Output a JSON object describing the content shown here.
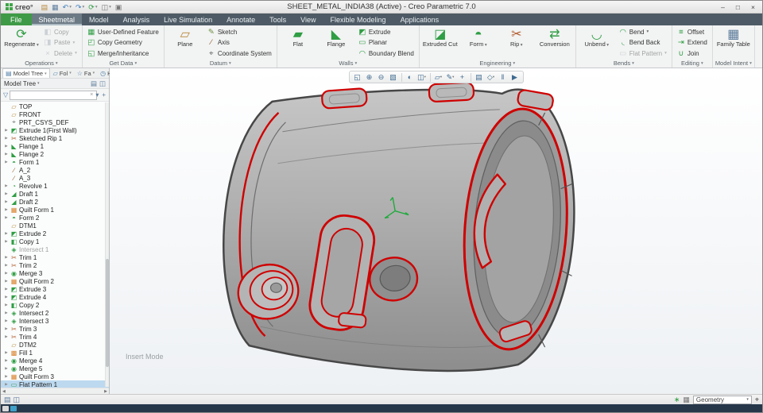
{
  "glyphs": {
    "caret": "▾",
    "tree_arrow": "▶",
    "scroll_left": "◀",
    "scroll_right": "▶"
  },
  "titlebar": {
    "logo_text": "creo°",
    "title": "SHEET_METAL_INDIA38 (Active) - Creo Parametric 7.0",
    "quick_access": [
      {
        "name": "open",
        "glyph": "▤",
        "color": "#b8893c"
      },
      {
        "name": "save",
        "glyph": "▦",
        "color": "#5f7f9f"
      },
      {
        "name": "undo",
        "glyph": "↶",
        "color": "#3f7fbf",
        "menu": true
      },
      {
        "name": "redo",
        "glyph": "↷",
        "color": "#3f7fbf",
        "menu": true
      },
      {
        "name": "regenerate-quick",
        "glyph": "⟳",
        "color": "#2f9e44",
        "menu": true
      },
      {
        "name": "window",
        "glyph": "◫",
        "color": "#777777",
        "menu": true
      },
      {
        "name": "close-window",
        "glyph": "▣",
        "color": "#777777"
      }
    ],
    "window_controls": [
      {
        "name": "minimize",
        "glyph": "–"
      },
      {
        "name": "maximize",
        "glyph": "□"
      },
      {
        "name": "close",
        "glyph": "×"
      }
    ]
  },
  "ribbon": {
    "tabs": [
      {
        "label": "File",
        "type": "file"
      },
      {
        "label": "Sheetmetal",
        "type": "active"
      },
      {
        "label": "Model"
      },
      {
        "label": "Analysis"
      },
      {
        "label": "Live Simulation"
      },
      {
        "label": "Annotate"
      },
      {
        "label": "Tools"
      },
      {
        "label": "View"
      },
      {
        "label": "Flexible Modeling"
      },
      {
        "label": "Applications"
      }
    ],
    "groups": [
      {
        "label": "Operations",
        "columns": [
          {
            "type": "big",
            "items": [
              {
                "label": "Regenerate",
                "menu": true,
                "icon": {
                  "glyph": "⟳",
                  "color": "#2f9e44"
                }
              }
            ]
          },
          {
            "type": "stack",
            "items": [
              {
                "label": "Copy",
                "disabled": true,
                "icon": {
                  "glyph": "◧",
                  "color": "#9aa4ad"
                }
              },
              {
                "label": "Paste",
                "disabled": true,
                "menu": true,
                "icon": {
                  "glyph": "◨",
                  "color": "#9aa4ad"
                }
              },
              {
                "label": "Delete",
                "disabled": true,
                "menu": true,
                "icon": {
                  "glyph": "×",
                  "color": "#9aa4ad"
                }
              }
            ]
          }
        ]
      },
      {
        "label": "Get Data",
        "columns": [
          {
            "type": "stack",
            "items": [
              {
                "label": "User-Defined Feature",
                "icon": {
                  "glyph": "▦",
                  "color": "#2f9e44"
                }
              },
              {
                "label": "Copy Geometry",
                "icon": {
                  "glyph": "◰",
                  "color": "#2f9e44"
                }
              },
              {
                "label": "Merge/Inheritance",
                "icon": {
                  "glyph": "◱",
                  "color": "#2f9e44"
                }
              }
            ]
          }
        ]
      },
      {
        "label": "Datum",
        "columns": [
          {
            "type": "big",
            "items": [
              {
                "label": "Plane",
                "icon": {
                  "glyph": "▱",
                  "color": "#b8893c"
                }
              }
            ]
          },
          {
            "type": "stack",
            "items": [
              {
                "label": "Sketch",
                "icon": {
                  "glyph": "✎",
                  "color": "#6a8f3f"
                }
              },
              {
                "label": "Axis",
                "icon": {
                  "glyph": "∕",
                  "color": "#8a5a2a"
                }
              },
              {
                "label": "Coordinate System",
                "icon": {
                  "glyph": "⌖",
                  "color": "#666666"
                }
              }
            ]
          }
        ]
      },
      {
        "label": "Walls",
        "columns": [
          {
            "type": "big",
            "items": [
              {
                "label": "Flat",
                "icon": {
                  "glyph": "▰",
                  "color": "#2f9e44"
                }
              },
              {
                "label": "Flange",
                "icon": {
                  "glyph": "◣",
                  "color": "#2f9e44"
                }
              }
            ]
          },
          {
            "type": "stack",
            "items": [
              {
                "label": "Extrude",
                "icon": {
                  "glyph": "◩",
                  "color": "#2f9e44"
                }
              },
              {
                "label": "Planar",
                "icon": {
                  "glyph": "▭",
                  "color": "#2f9e44"
                }
              },
              {
                "label": "Boundary Blend",
                "icon": {
                  "glyph": "◠",
                  "color": "#2f9e44"
                }
              }
            ]
          }
        ]
      },
      {
        "label": "Engineering",
        "columns": [
          {
            "type": "big",
            "items": [
              {
                "label": "Extruded Cut",
                "icon": {
                  "glyph": "◪",
                  "color": "#2f9e44"
                }
              },
              {
                "label": "Form",
                "menu": true,
                "icon": {
                  "glyph": "◓",
                  "color": "#2f9e44"
                }
              },
              {
                "label": "Rip",
                "menu": true,
                "icon": {
                  "glyph": "✂",
                  "color": "#b05a2a"
                }
              },
              {
                "label": "Conversion",
                "icon": {
                  "glyph": "⇄",
                  "color": "#2f9e44"
                }
              }
            ]
          }
        ]
      },
      {
        "label": "Bends",
        "columns": [
          {
            "type": "big",
            "items": [
              {
                "label": "Unbend",
                "menu": true,
                "icon": {
                  "glyph": "◡",
                  "color": "#2f9e44"
                }
              }
            ]
          },
          {
            "type": "stack",
            "items": [
              {
                "label": "Bend",
                "menu": true,
                "icon": {
                  "glyph": "◠",
                  "color": "#2f9e44"
                }
              },
              {
                "label": "Bend Back",
                "icon": {
                  "glyph": "◟",
                  "color": "#2f9e44"
                }
              },
              {
                "label": "Flat Pattern",
                "disabled": true,
                "menu": true,
                "icon": {
                  "glyph": "▭",
                  "color": "#9aa4ad"
                }
              }
            ]
          }
        ]
      },
      {
        "label": "Editing",
        "columns": [
          {
            "type": "stack",
            "items": [
              {
                "label": "Offset",
                "icon": {
                  "glyph": "≡",
                  "color": "#2f9e44"
                }
              },
              {
                "label": "Extend",
                "icon": {
                  "glyph": "⇥",
                  "color": "#2f9e44"
                }
              },
              {
                "label": "Join",
                "icon": {
                  "glyph": "∪",
                  "color": "#2f9e44"
                }
              }
            ]
          }
        ]
      },
      {
        "label": "Model Intent",
        "columns": [
          {
            "type": "big",
            "items": [
              {
                "label": "Family Table",
                "icon": {
                  "glyph": "▦",
                  "color": "#5a7a9a"
                }
              }
            ]
          }
        ]
      }
    ]
  },
  "left_panel": {
    "tabs": [
      {
        "label": "Model Tree",
        "glyph": "▤",
        "active": true
      },
      {
        "label": "Fol",
        "glyph": "▱"
      },
      {
        "label": "Fa",
        "glyph": "☆"
      },
      {
        "label": "Hi",
        "glyph": "◷"
      }
    ],
    "header": {
      "title": "Model Tree",
      "icons": [
        {
          "name": "tree-settings",
          "glyph": "▤"
        },
        {
          "name": "tree-layout",
          "glyph": "◫"
        }
      ]
    },
    "search": {
      "value": "",
      "funnel_glyph": "▽",
      "clear_glyph": "×",
      "icons": [
        {
          "name": "search-options",
          "glyph": "▾"
        },
        {
          "name": "add-filter",
          "glyph": "+"
        }
      ]
    },
    "tree_icons": {
      "plane": {
        "glyph": "▱",
        "color": "#b8893c"
      },
      "csys": {
        "glyph": "⌖",
        "color": "#777777"
      },
      "axis": {
        "glyph": "∕",
        "color": "#8a5a2a"
      },
      "extrude": {
        "glyph": "◩",
        "color": "#2f9e44"
      },
      "rip": {
        "glyph": "✂",
        "color": "#b05a2a"
      },
      "flange": {
        "glyph": "◣",
        "color": "#2f9e44"
      },
      "form": {
        "glyph": "◓",
        "color": "#2f9e44"
      },
      "revolve": {
        "glyph": "◔",
        "color": "#2f9e44"
      },
      "draft": {
        "glyph": "◢",
        "color": "#2f9e44"
      },
      "quilt": {
        "glyph": "▦",
        "color": "#d9822b"
      },
      "copy": {
        "glyph": "◧",
        "color": "#2f9e44"
      },
      "intersect": {
        "glyph": "◈",
        "color": "#2f9e44"
      },
      "trim": {
        "glyph": "✂",
        "color": "#b05a2a"
      },
      "merge": {
        "glyph": "◉",
        "color": "#2f9e44"
      },
      "fill": {
        "glyph": "▩",
        "color": "#d9822b"
      },
      "flatpattern": {
        "glyph": "▭",
        "color": "#2f9e44"
      }
    },
    "items": [
      {
        "label": "TOP",
        "icon": "plane"
      },
      {
        "label": "FRONT",
        "icon": "plane"
      },
      {
        "label": "PRT_CSYS_DEF",
        "icon": "csys"
      },
      {
        "label": "Extrude 1(First Wall)",
        "icon": "extrude",
        "expand": true
      },
      {
        "label": "Sketched Rip 1",
        "icon": "rip",
        "expand": true
      },
      {
        "label": "Flange 1",
        "icon": "flange",
        "expand": true
      },
      {
        "label": "Flange 2",
        "icon": "flange",
        "expand": true
      },
      {
        "label": "Form 1",
        "icon": "form",
        "expand": true
      },
      {
        "label": "A_2",
        "icon": "axis"
      },
      {
        "label": "A_3",
        "icon": "axis"
      },
      {
        "label": "Revolve 1",
        "icon": "revolve",
        "expand": true
      },
      {
        "label": "Draft 1",
        "icon": "draft",
        "expand": true
      },
      {
        "label": "Draft 2",
        "icon": "draft",
        "expand": true
      },
      {
        "label": "Quilt Form 1",
        "icon": "quilt",
        "expand": true
      },
      {
        "label": "Form 2",
        "icon": "form",
        "expand": true
      },
      {
        "label": "DTM1",
        "icon": "plane"
      },
      {
        "label": "Extrude 2",
        "icon": "extrude",
        "expand": true
      },
      {
        "label": "Copy 1",
        "icon": "copy",
        "expand": true
      },
      {
        "label": "Intersect 1",
        "icon": "intersect",
        "dim": true
      },
      {
        "label": "Trim 1",
        "icon": "trim",
        "expand": true
      },
      {
        "label": "Trim 2",
        "icon": "trim",
        "expand": true
      },
      {
        "label": "Merge 3",
        "icon": "merge",
        "expand": true
      },
      {
        "label": "Quilt Form 2",
        "icon": "quilt",
        "expand": true
      },
      {
        "label": "Extrude 3",
        "icon": "extrude",
        "expand": true
      },
      {
        "label": "Extrude 4",
        "icon": "extrude",
        "expand": true
      },
      {
        "label": "Copy 2",
        "icon": "copy",
        "expand": true
      },
      {
        "label": "Intersect 2",
        "icon": "intersect",
        "expand": true
      },
      {
        "label": "Intersect 3",
        "icon": "intersect",
        "expand": true
      },
      {
        "label": "Trim 3",
        "icon": "trim",
        "expand": true
      },
      {
        "label": "Trim 4",
        "icon": "trim",
        "expand": true
      },
      {
        "label": "DTM2",
        "icon": "plane"
      },
      {
        "label": "Fill 1",
        "icon": "fill",
        "expand": true
      },
      {
        "label": "Merge 4",
        "icon": "merge",
        "expand": true
      },
      {
        "label": "Merge 5",
        "icon": "merge",
        "expand": true
      },
      {
        "label": "Quilt Form 3",
        "icon": "quilt",
        "expand": true
      },
      {
        "label": "Flat Pattern 1",
        "icon": "flatpattern",
        "expand": true,
        "selected": true
      }
    ]
  },
  "viewport": {
    "insert_mode_label": "Insert Mode",
    "toolbar": [
      {
        "name": "refit",
        "glyph": "◱"
      },
      {
        "name": "zoom-in",
        "glyph": "⊕"
      },
      {
        "name": "zoom-out",
        "glyph": "⊖"
      },
      {
        "name": "repaint",
        "glyph": "▧"
      },
      {
        "sep": true
      },
      {
        "name": "shading-with-edges",
        "glyph": "◐"
      },
      {
        "name": "display-style",
        "glyph": "◫",
        "menu": true
      },
      {
        "sep": true
      },
      {
        "name": "datum-display",
        "glyph": "▱",
        "menu": true
      },
      {
        "name": "annotation-display",
        "glyph": "✎",
        "menu": true
      },
      {
        "name": "spin-center",
        "glyph": "+"
      },
      {
        "sep": true
      },
      {
        "name": "view-manager",
        "glyph": "▤"
      },
      {
        "name": "saved-orientations",
        "glyph": "◇",
        "menu": true
      },
      {
        "name": "pause",
        "glyph": "‖"
      },
      {
        "name": "play",
        "glyph": "▶"
      }
    ]
  },
  "status_bar": {
    "left_icons": [
      {
        "name": "model-tree-toggle",
        "glyph": "▤",
        "color": "#5a7a9a"
      },
      {
        "name": "browser-toggle",
        "glyph": "◫",
        "color": "#5a7a9a"
      }
    ],
    "right_icons_before": [
      {
        "name": "regen-status",
        "glyph": "∗",
        "color": "#2f9e44"
      },
      {
        "name": "selection-buffer",
        "glyph": "▦",
        "color": "#777777"
      }
    ],
    "filter": {
      "label": "Geometry"
    },
    "right_icons_after": [
      {
        "name": "find",
        "glyph": "⌖",
        "color": "#555555"
      }
    ]
  },
  "taskbar": {
    "items": [
      {
        "name": "task-item-1",
        "color": "#d9d9d9"
      },
      {
        "name": "task-item-2",
        "color": "#3fa0c8"
      }
    ]
  }
}
